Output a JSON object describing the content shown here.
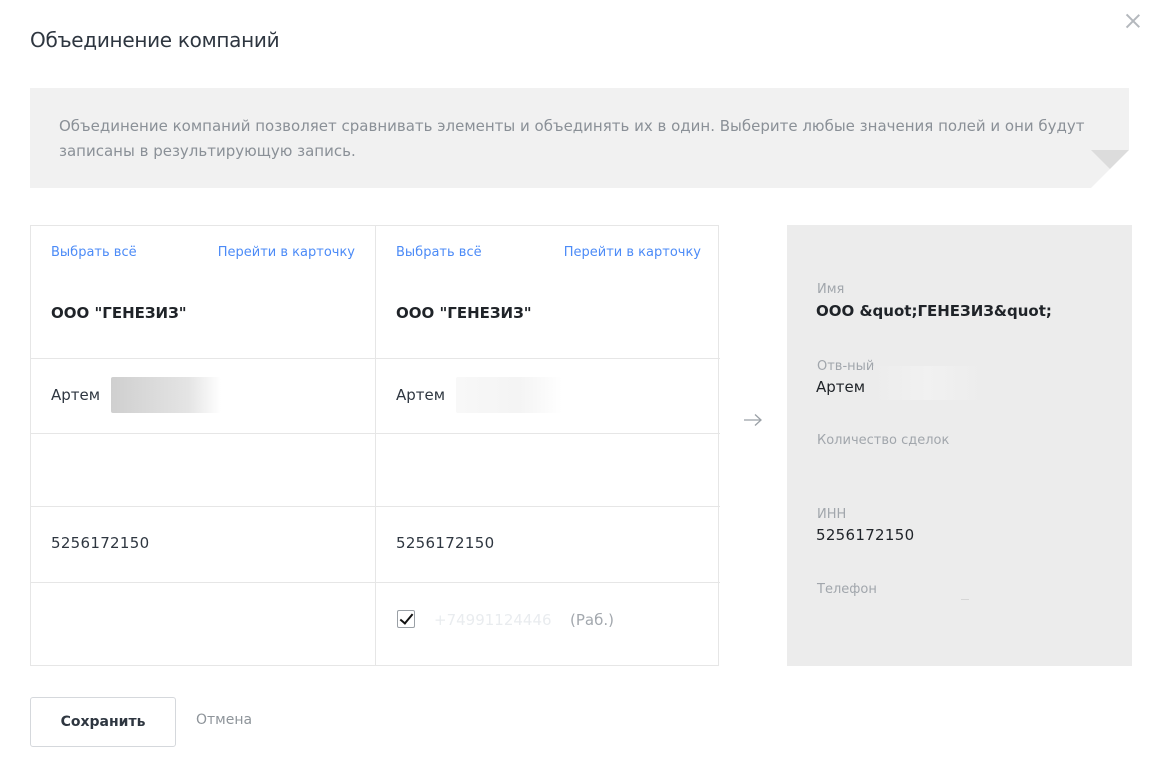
{
  "dialog": {
    "title": "Объединение компаний",
    "info_text": "Объединение компаний позволяет сравнивать элементы и объединять их в один. Выберите любые значения полей и они будут записаны в результирующую запись."
  },
  "columns": [
    {
      "select_all_label": "Выбрать всё",
      "open_card_label": "Перейти в карточку",
      "company_name": "ООО \"ГЕНЕЗИЗ\"",
      "responsible": "Артем",
      "deals": "",
      "inn": "5256172150",
      "phone": ""
    },
    {
      "select_all_label": "Выбрать всё",
      "open_card_label": "Перейти в карточку",
      "company_name": "ООО \"ГЕНЕЗИЗ\"",
      "responsible": "Артем",
      "deals": "",
      "inn": "5256172150",
      "phone_checked": true,
      "phone": "+74991124446",
      "phone_type": "(Раб.)"
    }
  ],
  "result": {
    "name_label": "Имя",
    "name_value": "ООО &quot;ГЕНЕЗИЗ&quot;",
    "responsible_label": "Отв-ный",
    "responsible_value": "Артем",
    "deals_label": "Количество сделок",
    "inn_label": "ИНН",
    "inn_value": "5256172150",
    "phone_label": "Телефон"
  },
  "footer": {
    "save_label": "Сохранить",
    "cancel_label": "Отмена"
  },
  "colors": {
    "link": "#4c8bf7",
    "info_bg": "#f1f1f1",
    "result_bg": "#ececec"
  },
  "icons": [
    "close-icon",
    "arrow-right-icon",
    "checkmark-icon"
  ]
}
